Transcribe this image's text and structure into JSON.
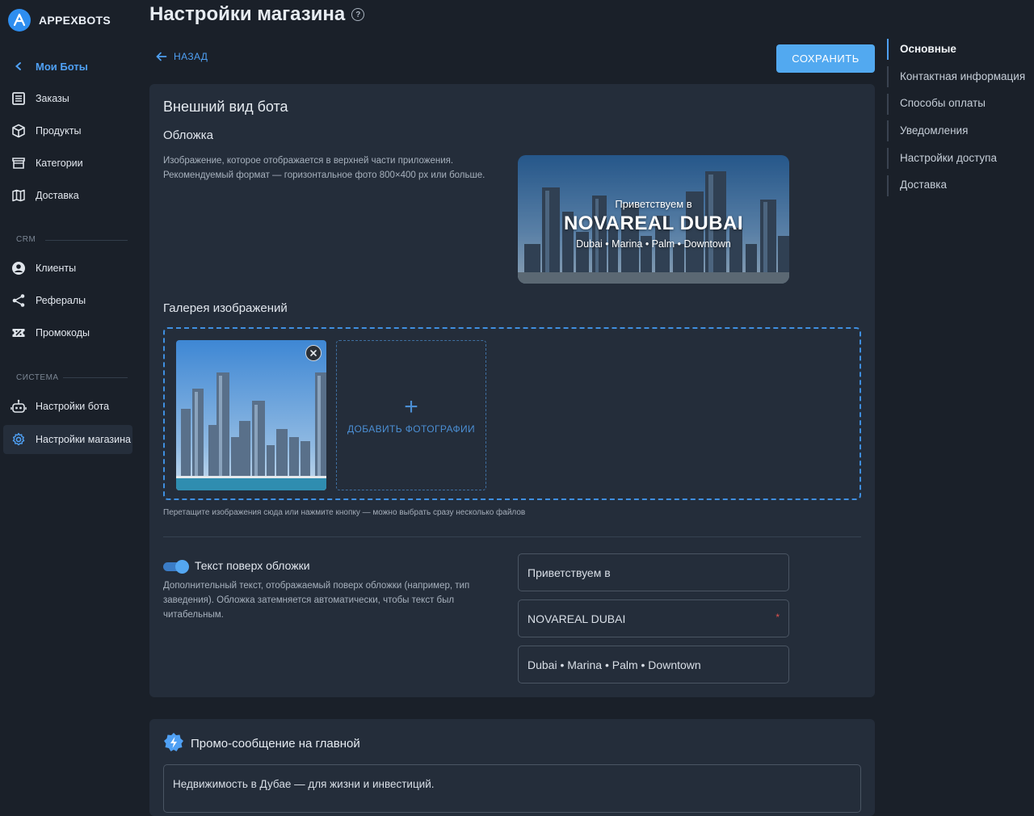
{
  "brand": {
    "name": "APPEXBOTS",
    "logo_letter": "A"
  },
  "sidebar": {
    "back_label": "Мои Боты",
    "items": [
      {
        "label": "Заказы",
        "icon": "orders-icon"
      },
      {
        "label": "Продукты",
        "icon": "cube-icon"
      },
      {
        "label": "Категории",
        "icon": "storefront-icon"
      },
      {
        "label": "Доставка",
        "icon": "map-icon"
      }
    ],
    "crm_label": "CRM",
    "crm_items": [
      {
        "label": "Клиенты",
        "icon": "account-icon"
      },
      {
        "label": "Рефералы",
        "icon": "share-icon"
      },
      {
        "label": "Промокоды",
        "icon": "ticket-percent-icon"
      }
    ],
    "system_label": "СИСТЕМА",
    "system_items": [
      {
        "label": "Настройки бота",
        "icon": "robot-icon"
      },
      {
        "label": "Настройки магазина",
        "icon": "cog-icon",
        "active": true
      }
    ]
  },
  "header": {
    "title": "Настройки магазина",
    "help_glyph": "?",
    "back_label": "НАЗАД",
    "save_label": "СОХРАНИТЬ"
  },
  "appearance": {
    "title": "Внешний вид бота",
    "cover_title": "Обложка",
    "cover_desc_1": "Изображение, которое отображается в верхней части приложения.",
    "cover_desc_2": "Рекомендуемый формат — горизонтальное фото 800×400 px или больше.",
    "cover_overlay": {
      "line1": "Приветствуем в",
      "line2": "NOVAREAL DUBAI",
      "line3": "Dubai • Marina • Palm • Downtown"
    },
    "gallery_title": "Галерея изображений",
    "add_photo_label": "ДОБАВИТЬ ФОТОГРАФИИ",
    "gallery_hint": "Перетащите изображения сюда или нажмите кнопку — можно выбрать сразу несколько файлов",
    "overlay_toggle_label": "Текст поверх обложки",
    "overlay_toggle_on": true,
    "overlay_desc_1": "Дополнительный текст, отображаемый поверх обложки (например, тип",
    "overlay_desc_2": "заведения). Обложка затемняется автоматически, чтобы текст был",
    "overlay_desc_3": "читабельным.",
    "fields": {
      "line1": "Приветствуем в",
      "line2": "NOVAREAL DUBAI",
      "line2_required_mark": "*",
      "line3": "Dubai • Marina • Palm • Downtown"
    }
  },
  "promo": {
    "title": "Промо-сообщение на главной",
    "text": "Недвижимость в Дубае — для жизни и инвестиций."
  },
  "toc": {
    "items": [
      "Основные",
      "Контактная информация",
      "Способы оплаты",
      "Уведомления",
      "Настройки доступа",
      "Доставка"
    ],
    "active_index": 0
  },
  "colors": {
    "accent": "#4fa0f4",
    "save_button": "#52a9f0",
    "background": "#1a2029",
    "card": "#242d3a"
  }
}
